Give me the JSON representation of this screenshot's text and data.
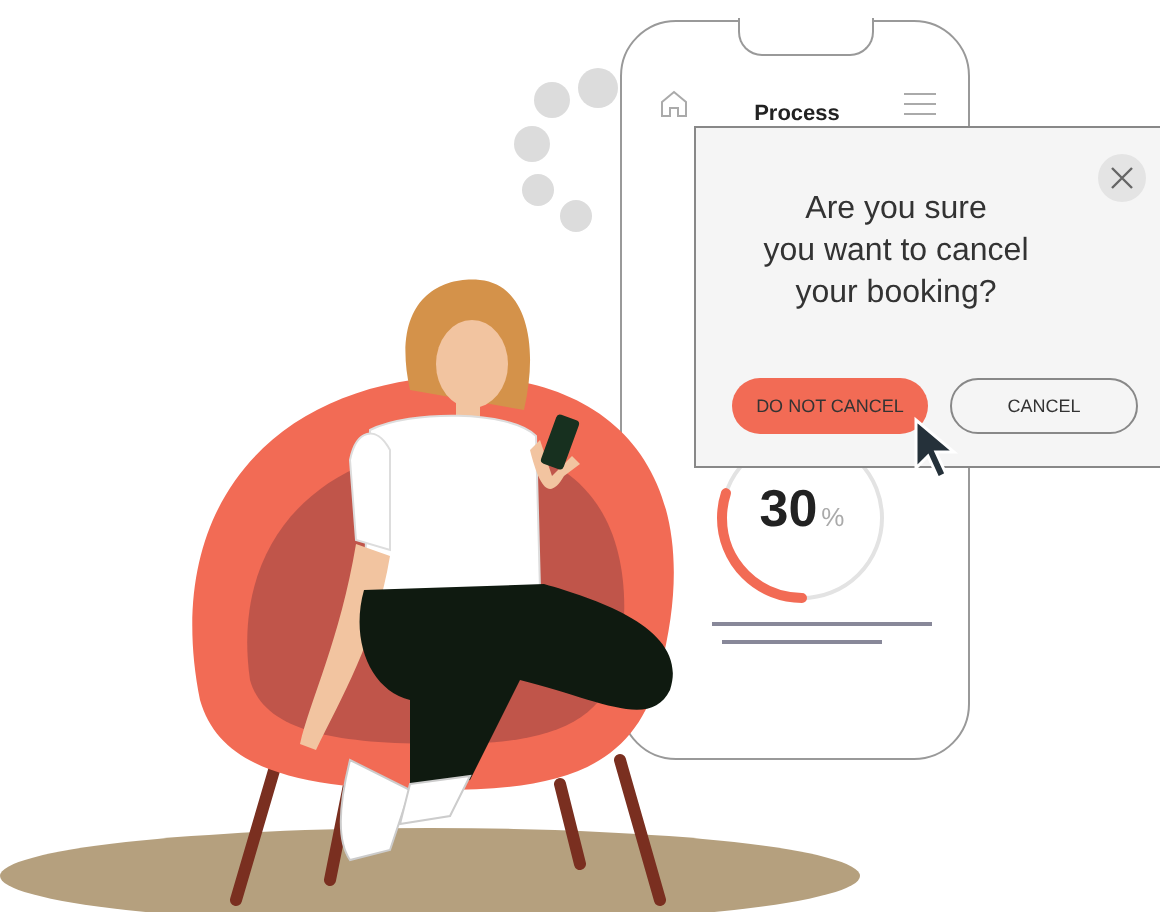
{
  "phone": {
    "title": "Process",
    "progress": {
      "value": "30",
      "unit": "%",
      "level": 0.3
    }
  },
  "dialog": {
    "message_lines": [
      "Are you sure",
      "you want to cancel",
      "your booking?"
    ],
    "buttons": [
      {
        "label": "DO NOT CANCEL",
        "kind": "primary"
      },
      {
        "label": "CANCEL",
        "kind": "secondary"
      }
    ]
  }
}
